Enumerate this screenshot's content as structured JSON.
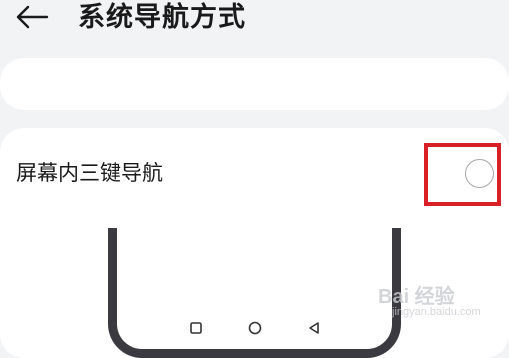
{
  "header": {
    "back_icon": "arrow-left-icon",
    "title": "系统导航方式"
  },
  "options": [
    {
      "label": "屏幕内三键导航",
      "selected": false,
      "highlighted": true
    }
  ],
  "preview": {
    "nav_icons": [
      "square-recent-icon",
      "circle-home-icon",
      "triangle-back-icon"
    ]
  },
  "watermark": {
    "text": "Bai 经验",
    "sub_text": "jingyan.baidu.com"
  },
  "colors": {
    "background": "#f1f3f5",
    "card": "#ffffff",
    "highlight": "#d92027",
    "phone_frame": "#3a3a40"
  }
}
